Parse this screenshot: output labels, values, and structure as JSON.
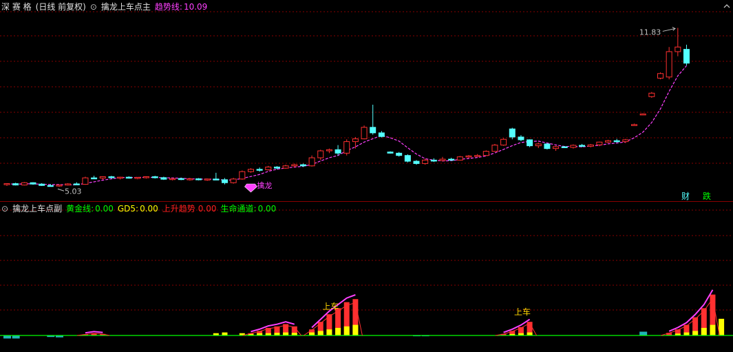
{
  "main_panel": {
    "stock_label": "深 赛 格",
    "period_label": "(日线 前复权)",
    "indicator_name": "擒龙上车点主",
    "trend_label": "趋势线:",
    "trend_value": "10.09",
    "high_label": "11.83",
    "low_label": "5.03",
    "signal_label": "擒龙",
    "finance_badge": "财",
    "limit_badge": "跌"
  },
  "sub_panel": {
    "indicator_name": "擒龙上车点副",
    "items": [
      {
        "label": "黄金线:",
        "value": "0.00",
        "color": "#00ff00"
      },
      {
        "label": "GD5:",
        "value": "0.00",
        "color": "#ffff00"
      },
      {
        "label": "上升趋势",
        "value": "0.00",
        "color": "#ff2020"
      },
      {
        "label": "生命通道:",
        "value": "0.00",
        "color": "#00ff00"
      }
    ],
    "signal_labels": [
      "上车",
      "上车"
    ]
  },
  "colors": {
    "up": "#ff3030",
    "down": "#54ffff",
    "trend": "#ff40ff",
    "grid": "#8a0000",
    "accent_magenta": "#ff40ff",
    "yellow": "#ffff00",
    "green": "#00ff00"
  },
  "chart_data": [
    {
      "type": "candlestick",
      "title": "擒龙上车点主",
      "ylim": [
        4.5,
        12.5
      ],
      "candles": [
        [
          5.05,
          5.1,
          4.98,
          5.08
        ],
        [
          5.08,
          5.12,
          5.0,
          5.02
        ],
        [
          5.02,
          5.15,
          5.0,
          5.12
        ],
        [
          5.12,
          5.14,
          5.03,
          5.06
        ],
        [
          5.06,
          5.1,
          4.98,
          5.0
        ],
        [
          5.0,
          5.06,
          4.95,
          4.98
        ],
        [
          4.98,
          5.04,
          4.94,
          5.02
        ],
        [
          5.02,
          5.1,
          5.0,
          5.07
        ],
        [
          5.07,
          5.14,
          5.02,
          5.05
        ],
        [
          5.05,
          5.38,
          5.03,
          5.33
        ],
        [
          5.33,
          5.42,
          5.28,
          5.32
        ],
        [
          5.32,
          5.4,
          5.25,
          5.38
        ],
        [
          5.38,
          5.42,
          5.3,
          5.34
        ],
        [
          5.34,
          5.38,
          5.26,
          5.36
        ],
        [
          5.36,
          5.4,
          5.3,
          5.32
        ],
        [
          5.32,
          5.37,
          5.27,
          5.35
        ],
        [
          5.35,
          5.4,
          5.3,
          5.38
        ],
        [
          5.38,
          5.42,
          5.3,
          5.34
        ],
        [
          5.34,
          5.38,
          5.24,
          5.27
        ],
        [
          5.27,
          5.32,
          5.22,
          5.3
        ],
        [
          5.3,
          5.34,
          5.23,
          5.26
        ],
        [
          5.26,
          5.33,
          5.21,
          5.29
        ],
        [
          5.29,
          5.32,
          5.22,
          5.25
        ],
        [
          5.25,
          5.3,
          5.2,
          5.28
        ],
        [
          5.28,
          5.55,
          5.24,
          5.25
        ],
        [
          5.25,
          5.32,
          5.05,
          5.12
        ],
        [
          5.12,
          5.33,
          5.08,
          5.28
        ],
        [
          5.28,
          5.65,
          5.25,
          5.6
        ],
        [
          5.6,
          5.75,
          5.55,
          5.7
        ],
        [
          5.7,
          5.78,
          5.6,
          5.68
        ],
        [
          5.68,
          5.85,
          5.65,
          5.8
        ],
        [
          5.8,
          5.84,
          5.7,
          5.75
        ],
        [
          5.75,
          5.9,
          5.72,
          5.85
        ],
        [
          5.85,
          5.95,
          5.78,
          5.9
        ],
        [
          5.9,
          5.95,
          5.8,
          5.85
        ],
        [
          5.85,
          6.3,
          5.82,
          6.2
        ],
        [
          6.2,
          6.55,
          6.1,
          6.5
        ],
        [
          6.5,
          6.6,
          6.4,
          6.55
        ],
        [
          6.55,
          6.75,
          6.3,
          6.4
        ],
        [
          6.4,
          7.0,
          6.3,
          6.9
        ],
        [
          6.9,
          7.1,
          6.6,
          7.02
        ],
        [
          7.02,
          7.6,
          7.0,
          7.52
        ],
        [
          7.52,
          8.5,
          7.2,
          7.28
        ],
        [
          7.28,
          7.36,
          7.08,
          7.12
        ],
        [
          6.45,
          6.48,
          6.38,
          6.4
        ],
        [
          6.4,
          6.45,
          6.25,
          6.3
        ],
        [
          6.3,
          6.35,
          6.0,
          6.05
        ],
        [
          6.05,
          6.1,
          5.9,
          5.95
        ],
        [
          5.95,
          6.15,
          5.9,
          6.1
        ],
        [
          6.1,
          6.18,
          6.02,
          6.08
        ],
        [
          6.08,
          6.24,
          6.04,
          6.14
        ],
        [
          6.14,
          6.2,
          6.06,
          6.1
        ],
        [
          6.1,
          6.28,
          6.08,
          6.24
        ],
        [
          6.24,
          6.32,
          6.18,
          6.28
        ],
        [
          6.28,
          6.36,
          6.24,
          6.3
        ],
        [
          6.3,
          6.52,
          6.28,
          6.48
        ],
        [
          6.48,
          6.8,
          6.46,
          6.75
        ],
        [
          6.75,
          7.05,
          6.72,
          7.0
        ],
        [
          7.45,
          7.5,
          7.0,
          7.1
        ],
        [
          7.1,
          7.18,
          6.92,
          6.98
        ],
        [
          6.98,
          7.0,
          6.66,
          6.72
        ],
        [
          6.72,
          6.86,
          6.62,
          6.8
        ],
        [
          6.8,
          6.83,
          6.56,
          6.6
        ],
        [
          6.6,
          6.72,
          6.5,
          6.68
        ],
        [
          6.68,
          6.7,
          6.62,
          6.65
        ],
        [
          6.65,
          6.78,
          6.6,
          6.74
        ],
        [
          6.74,
          6.8,
          6.66,
          6.7
        ],
        [
          6.7,
          6.8,
          6.65,
          6.76
        ],
        [
          6.76,
          6.9,
          6.7,
          6.88
        ],
        [
          6.88,
          6.98,
          6.84,
          6.94
        ],
        [
          6.94,
          7.02,
          6.86,
          6.9
        ],
        [
          6.9,
          7.02,
          6.84,
          6.98
        ],
        [
          7.62,
          7.68,
          7.6,
          7.64
        ],
        [
          8.08,
          8.12,
          8.06,
          8.1
        ],
        [
          8.85,
          9.05,
          8.8,
          9.0
        ],
        [
          9.65,
          9.9,
          9.6,
          9.85
        ],
        [
          9.7,
          11.0,
          9.6,
          10.8
        ],
        [
          10.8,
          11.83,
          10.6,
          11.0
        ],
        [
          10.9,
          11.1,
          10.2,
          10.3
        ]
      ]
    },
    {
      "type": "bar",
      "title": "擒龙上车点副",
      "series": [
        {
          "name": "上升趋势",
          "values": [
            0,
            0,
            0,
            0,
            0,
            0,
            0,
            0,
            0,
            0.15,
            0.3,
            0.2,
            0,
            0,
            0,
            0,
            0,
            0,
            0,
            0,
            0,
            0,
            0,
            0,
            0,
            0,
            0,
            0,
            0.3,
            0.6,
            1.0,
            1.2,
            1.5,
            1.2,
            0,
            0.8,
            1.8,
            2.8,
            3.6,
            4.4,
            4.8,
            0,
            0,
            0,
            0,
            0,
            0,
            0,
            0,
            0,
            0,
            0,
            0,
            0,
            0,
            0,
            0,
            0.2,
            0.6,
            1.1,
            1.8,
            0,
            0,
            0,
            0,
            0,
            0,
            0,
            0,
            0,
            0,
            0,
            0,
            0,
            0,
            0,
            0.35,
            0.8,
            1.4,
            2.4,
            3.6,
            5.4,
            0
          ]
        },
        {
          "name": "GD5",
          "values": [
            0,
            0,
            0,
            0,
            0,
            0,
            0,
            0,
            0,
            0,
            0,
            0,
            0,
            0,
            0,
            0,
            0,
            0,
            0,
            0,
            0,
            0,
            0,
            0,
            0.3,
            0.4,
            0,
            0.3,
            0.2,
            0.3,
            0.3,
            0.35,
            0.4,
            0.35,
            0,
            0.4,
            0.6,
            0.8,
            1.0,
            1.2,
            1.4,
            0,
            0,
            0,
            0,
            0,
            0,
            0,
            0,
            0,
            0,
            0,
            0,
            0,
            0,
            0,
            0,
            0,
            0.2,
            0.3,
            0.4,
            0,
            0,
            0,
            0,
            0,
            0,
            0,
            0,
            0,
            0,
            0,
            0,
            0,
            0,
            0,
            0,
            0.25,
            0.4,
            0.6,
            1.0,
            1.4,
            2.2,
            0
          ]
        },
        {
          "name": "生命通道",
          "values": [
            -0.4,
            -0.4,
            0,
            0,
            0,
            -0.2,
            -0.25,
            0,
            0,
            0,
            0,
            0,
            0,
            0,
            0,
            0,
            0,
            0,
            0,
            0,
            0,
            0,
            0,
            0,
            0,
            0,
            0,
            0,
            0,
            0,
            0,
            0,
            0,
            0,
            0,
            0,
            0,
            0,
            0,
            0,
            0,
            0,
            0,
            0,
            0,
            0,
            0,
            -0.1,
            -0.1,
            0,
            0,
            0,
            0,
            0,
            0,
            0,
            0,
            0,
            0,
            0,
            0,
            0,
            0,
            0,
            0,
            0,
            0,
            0,
            0,
            0,
            0,
            0,
            0,
            0.5,
            0,
            0,
            0,
            0,
            0,
            0,
            0,
            0,
            0
          ]
        }
      ]
    }
  ]
}
